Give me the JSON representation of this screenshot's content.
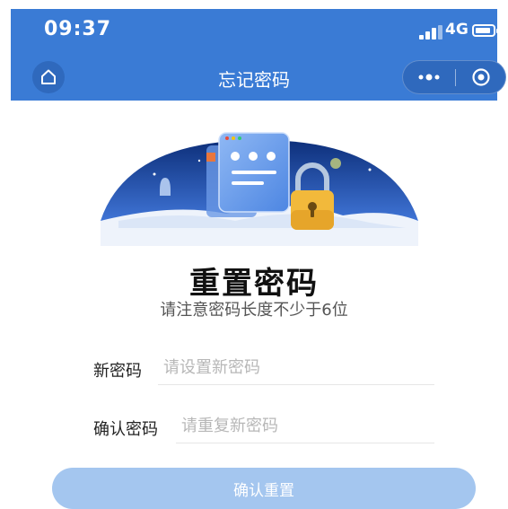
{
  "status_bar": {
    "time": "09:37",
    "network": "4G"
  },
  "nav": {
    "title": "忘记密码",
    "home_icon": "home-icon",
    "more_icon": "more-dots-icon",
    "close_icon": "target-close-icon"
  },
  "heading": {
    "title": "重置密码",
    "subtitle": "请注意密码长度不少于6位"
  },
  "form": {
    "new_password": {
      "label": "新密码",
      "placeholder": "请设置新密码",
      "value": ""
    },
    "confirm_password": {
      "label": "确认密码",
      "placeholder": "请重复新密码",
      "value": ""
    }
  },
  "submit_label": "确认重置",
  "colors": {
    "primary": "#3a7bd5",
    "button_disabled": "#a4c6ef",
    "lock": "#f2b93b"
  }
}
